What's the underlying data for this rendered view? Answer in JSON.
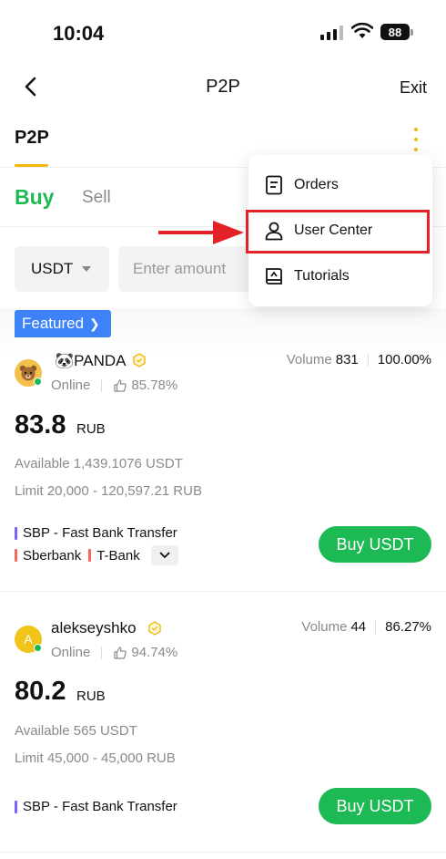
{
  "status_bar": {
    "time": "10:04",
    "battery": "88"
  },
  "nav": {
    "title": "P2P",
    "exit_label": "Exit"
  },
  "tabs": {
    "main": "P2P",
    "buy": "Buy",
    "sell": "Sell"
  },
  "filters": {
    "currency": "USDT",
    "amount_placeholder": "Enter amount"
  },
  "menu": {
    "items": [
      {
        "label": "Orders",
        "icon": "document-icon"
      },
      {
        "label": "User Center",
        "icon": "user-icon"
      },
      {
        "label": "Tutorials",
        "icon": "book-icon"
      }
    ]
  },
  "featured_label": "Featured",
  "offers": [
    {
      "name": "PANDA",
      "name_prefix": "🐼",
      "status": "Online",
      "rating": "85.78%",
      "volume_label": "Volume",
      "volume": "831",
      "completion": "100.00%",
      "price": "83.8",
      "currency": "RUB",
      "available_label": "Available",
      "available": "1,439.1076 USDT",
      "limit_label": "Limit",
      "limit": "20,000 - 120,597.21 RUB",
      "payments": [
        "SBP - Fast Bank Transfer",
        "Sberbank",
        "T-Bank"
      ],
      "button": "Buy USDT"
    },
    {
      "name": "alekseyshko",
      "avatar_letter": "A",
      "status": "Online",
      "rating": "94.74%",
      "volume_label": "Volume",
      "volume": "44",
      "completion": "86.27%",
      "price": "80.2",
      "currency": "RUB",
      "available_label": "Available",
      "available": "565 USDT",
      "limit_label": "Limit",
      "limit": "45,000 - 45,000 RUB",
      "payments": [
        "SBP - Fast Bank Transfer"
      ],
      "button": "Buy USDT"
    }
  ],
  "colors": {
    "accent_green": "#1db954",
    "brand_yellow": "#f0b90b",
    "featured_blue": "#3d82f6",
    "highlight_red": "#e32129"
  }
}
